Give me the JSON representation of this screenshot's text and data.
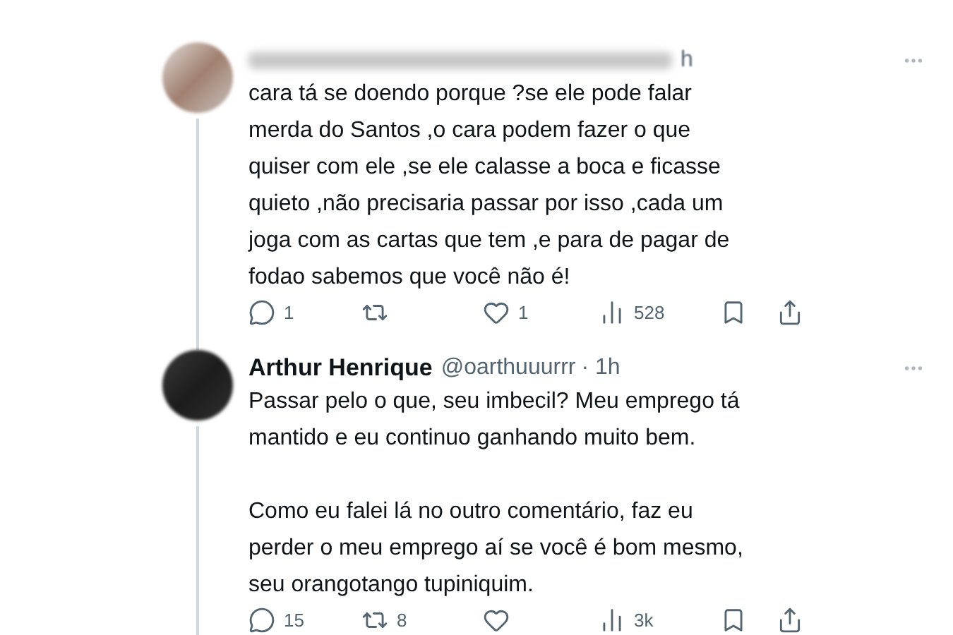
{
  "tweets": [
    {
      "author_name_blurred": true,
      "time": "h",
      "text": "cara tá se doendo porque ?se ele pode falar\nmerda do Santos ,o cara podem fazer o que\nquiser com ele ,se ele calasse a boca e ficasse\nquieto ,não precisaria passar por isso ,cada um\njoga com as cartas que tem ,e para de pagar de\nfodao sabemos que você não é!",
      "actions": [
        {
          "kind": "reply",
          "count": "1"
        },
        {
          "kind": "retweet"
        },
        {
          "kind": "like",
          "count": "1"
        },
        {
          "kind": "views",
          "count": "528"
        },
        {
          "kind": "bookmark"
        },
        {
          "kind": "share"
        }
      ]
    },
    {
      "author_name_blurred": false,
      "author_name": "Arthur Henrique",
      "handle": "@oarthuuurrr",
      "time": "· 1h",
      "text": "Passar pelo o que, seu imbecil? Meu emprego tá\nmantido e eu continuo ganhando muito bem.\n\nComo eu falei lá no outro comentário, faz eu\nperder o meu emprego aí se você é bom mesmo,\nseu orangotango tupiniquim.",
      "actions": [
        {
          "kind": "reply",
          "count": "15"
        },
        {
          "kind": "retweet",
          "count": "8"
        },
        {
          "kind": "like"
        },
        {
          "kind": "views",
          "count": "3k"
        },
        {
          "kind": "bookmark"
        },
        {
          "kind": "share"
        }
      ]
    }
  ]
}
